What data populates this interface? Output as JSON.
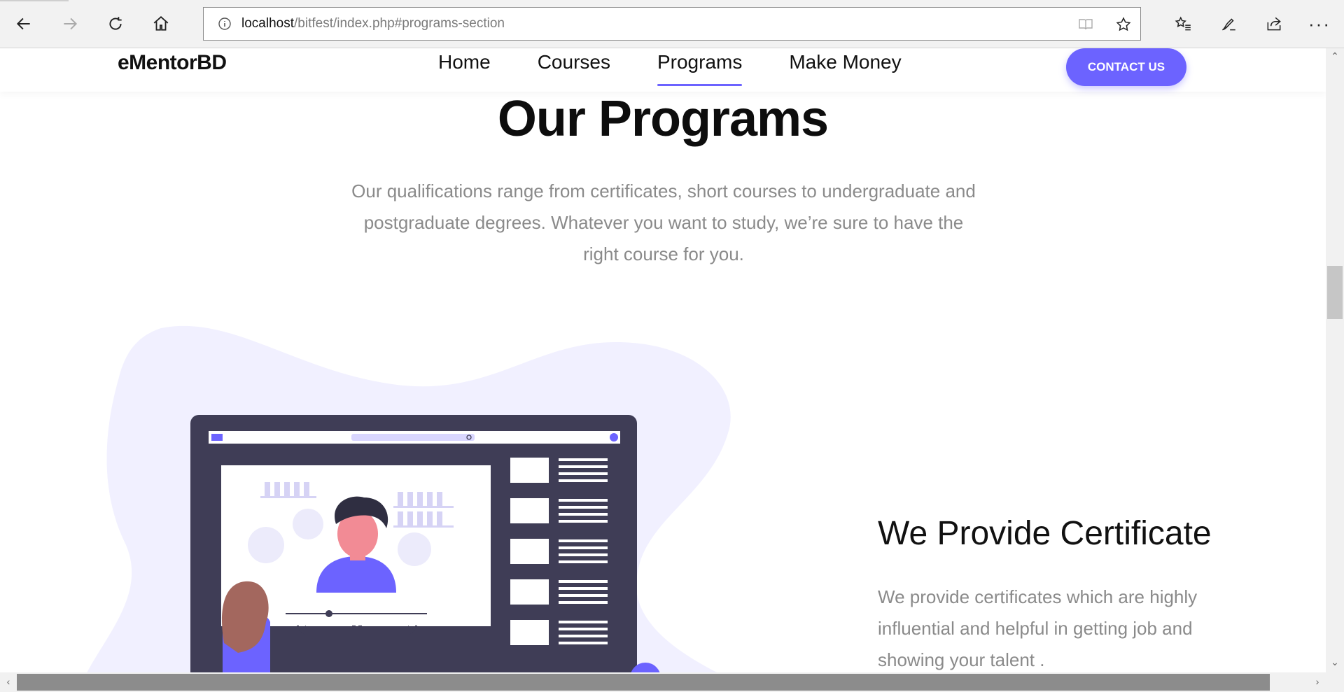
{
  "browser": {
    "url_host": "localhost",
    "url_path": "/bitfest/index.php#programs-section"
  },
  "site": {
    "logo": "eMentorBD",
    "menu": [
      "Home",
      "Courses",
      "Programs",
      "Make Money"
    ],
    "active_menu": "Programs",
    "contact_label": "CONTACT US"
  },
  "programs": {
    "title": "Our Programs",
    "description_lines": [
      "Our qualifications range from certificates, short courses to undergraduate and",
      "postgraduate degrees. Whatever you want to study, we’re sure to have the",
      "right course for you."
    ]
  },
  "feature": {
    "title": "We Provide Certificate",
    "description_lines": [
      "We provide certificates which are highly",
      "influential and helpful in getting job and",
      "showing your talent ."
    ]
  },
  "colors": {
    "accent": "#6c63ff",
    "blob": "#f1f0ff",
    "device": "#3f3d56",
    "skin": "#f28b95",
    "hair": "#2f2e41"
  }
}
